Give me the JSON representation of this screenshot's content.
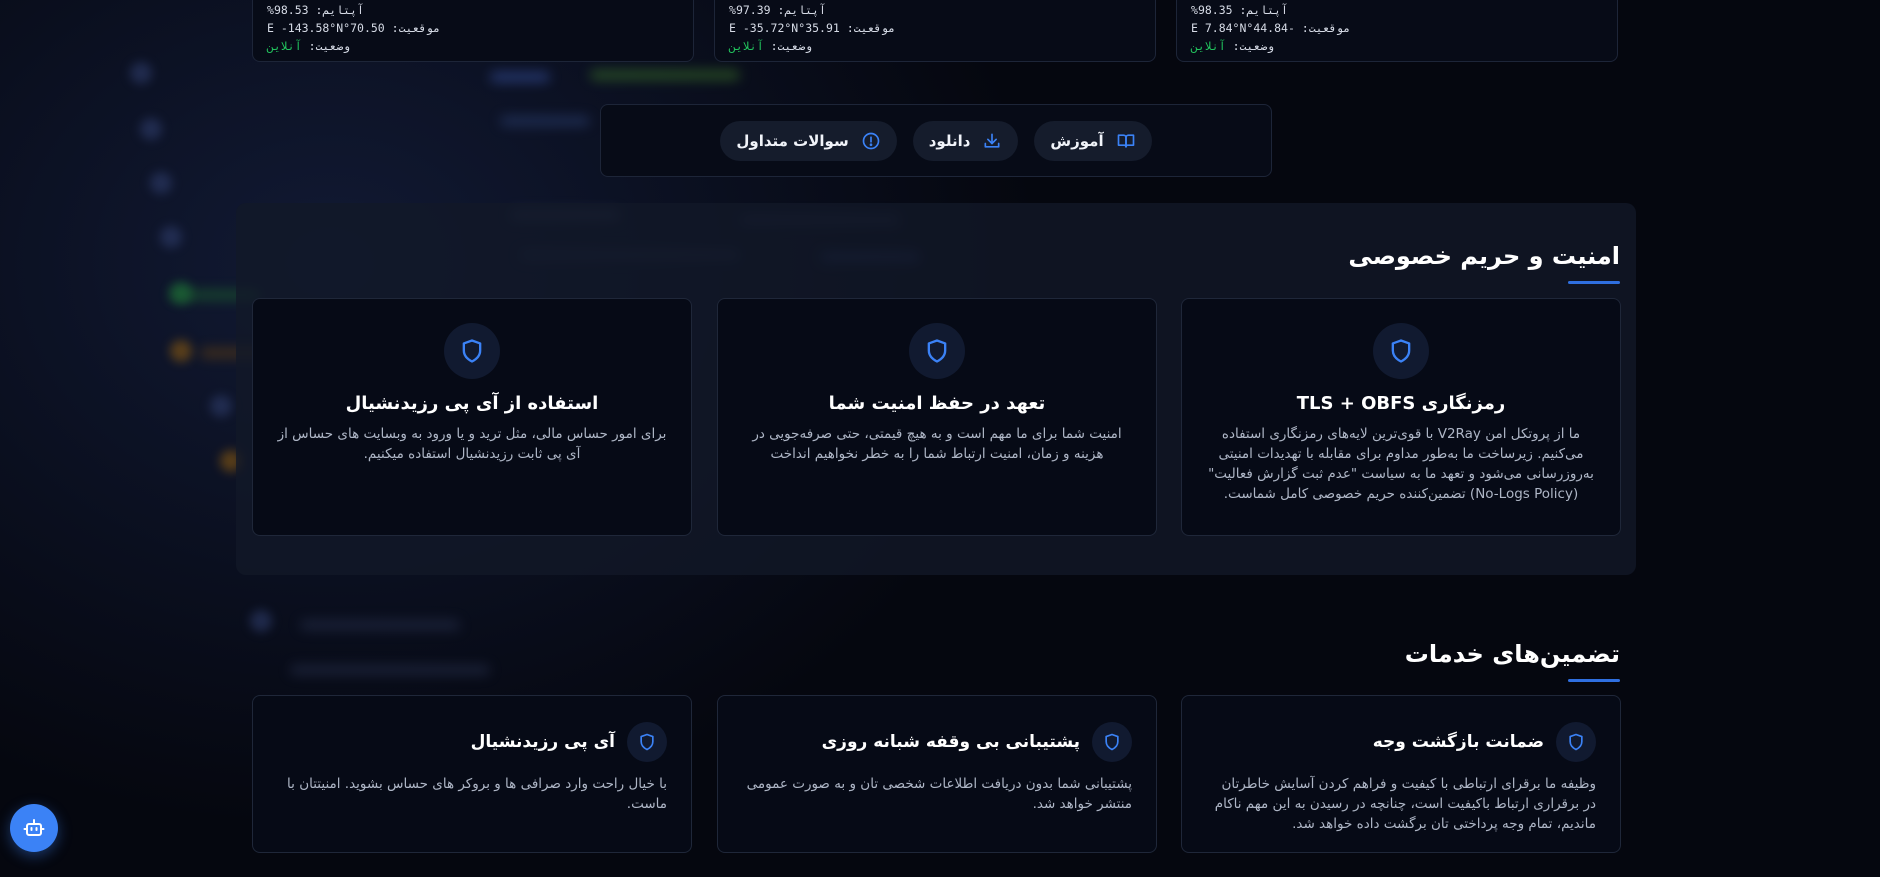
{
  "servers": [
    {
      "uptime": "آپتایم: 98.53%",
      "location": "موقعیت: 70.50°E -143.58°N",
      "status_label": "وضعیت:",
      "status_value": "آنلاین"
    },
    {
      "uptime": "آپتایم: 97.39%",
      "location": "موقعیت: 35.91°E -35.72°N",
      "status_label": "وضعیت:",
      "status_value": "آنلاین"
    },
    {
      "uptime": "آپتایم: 98.35%",
      "location": "موقعیت: -44.84°E 7.84°N",
      "status_label": "وضعیت:",
      "status_value": "آنلاین"
    }
  ],
  "quick_links": [
    {
      "label": "آموزش",
      "icon": "book-icon"
    },
    {
      "label": "دانلود",
      "icon": "download-icon"
    },
    {
      "label": "سوالات متداول",
      "icon": "info-icon"
    }
  ],
  "security": {
    "title": "امنیت و حریم خصوصی",
    "cards": [
      {
        "title": "رمزنگاری TLS + OBFS",
        "description": "ما از پروتکل امن V2Ray با قوی‌ترین لایه‌های رمزنگاری استفاده می‌کنیم. زیرساخت ما به‌طور مداوم برای مقابله با تهدیدات امنیتی به‌روزرسانی می‌شود و تعهد ما به سیاست \"عدم ثبت گزارش فعالیت\" (No-Logs Policy) تضمین‌کننده حریم خصوصی کامل شماست."
      },
      {
        "title": "تعهد در حفظ امنیت شما",
        "description": "امنیت شما برای ما مهم است و به هیچ قیمتی، حتی صرفه‌جویی در هزینه و زمان، امنیت ارتباط شما را به خطر نخواهیم انداخت"
      },
      {
        "title": "استفاده از آی پی رزیدنشیال",
        "description": "برای امور حساس مالی، مثل ترید و یا ورود به وبسایت های حساس از آی پی ثابت رزیدنشیال استفاده میکنیم."
      }
    ]
  },
  "guarantees": {
    "title": "تضمین‌های خدمات",
    "cards": [
      {
        "title": "ضمانت بازگشت وجه",
        "description": "وظیفه ما برقرای ارتباطی با کیفیت و فراهم کردن آسایش خاطرتان در برقراری ارتباط باکیفیت است، چنانچه در رسیدن به این مهم ناکام ماندیم، تمام وجه پرداختی تان برگشت داده خواهد شد."
      },
      {
        "title": "پشتیبانی بی وقفه شبانه روزی",
        "description": "پشتیبانی شما بدون دریافت اطلاعات شخصی تان و به صورت عمومی منتشر خواهد شد."
      },
      {
        "title": "آی پی رزیدنشیال",
        "description": "با خیال راحت وارد صرافی ها و بروکر های حساس بشوید. امنیتتان با ماست."
      }
    ]
  },
  "colors": {
    "accent": "#2f6fe0",
    "online": "#22c55e",
    "bot_button": "#3b82f6"
  }
}
